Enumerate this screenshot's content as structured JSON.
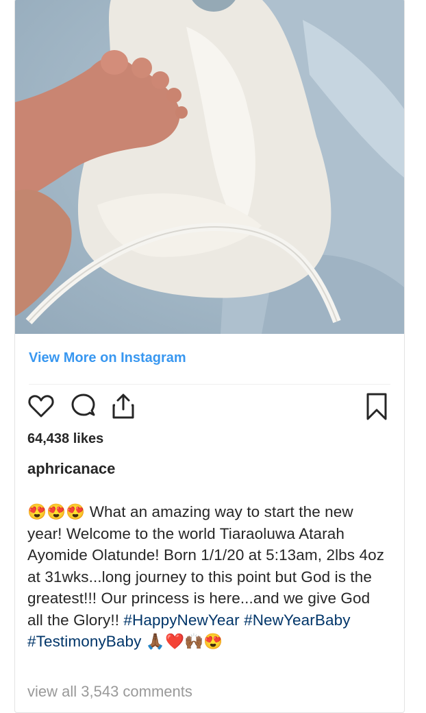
{
  "post": {
    "view_more_label": "View More on Instagram",
    "likes": "64,438 likes",
    "username": "aphricanace",
    "caption_lead_emoji": "😍😍😍",
    "caption_text": " What an amazing way to start the new year! Welcome to the world Tiaraoluwa Atarah Ayomide Olatunde! Born 1/1/20 at 5:13am, 2lbs 4oz at 31wks...long journey to this point but God is the greatest!!! Our princess is here...and we give God all the Glory!! ",
    "hashtags": [
      "#HappyNewYear",
      "#NewYearBaby",
      "#TestimonyBaby"
    ],
    "caption_tail_emoji": " 🙏🏾❤️🙌🏾😍",
    "view_comments": "view all 3,543 comments"
  },
  "icons": [
    "heart-icon",
    "comment-icon",
    "share-icon",
    "bookmark-icon"
  ],
  "colors": {
    "link_blue": "#3897f0",
    "hashtag": "#003569",
    "text": "#262626",
    "muted": "#999999"
  }
}
